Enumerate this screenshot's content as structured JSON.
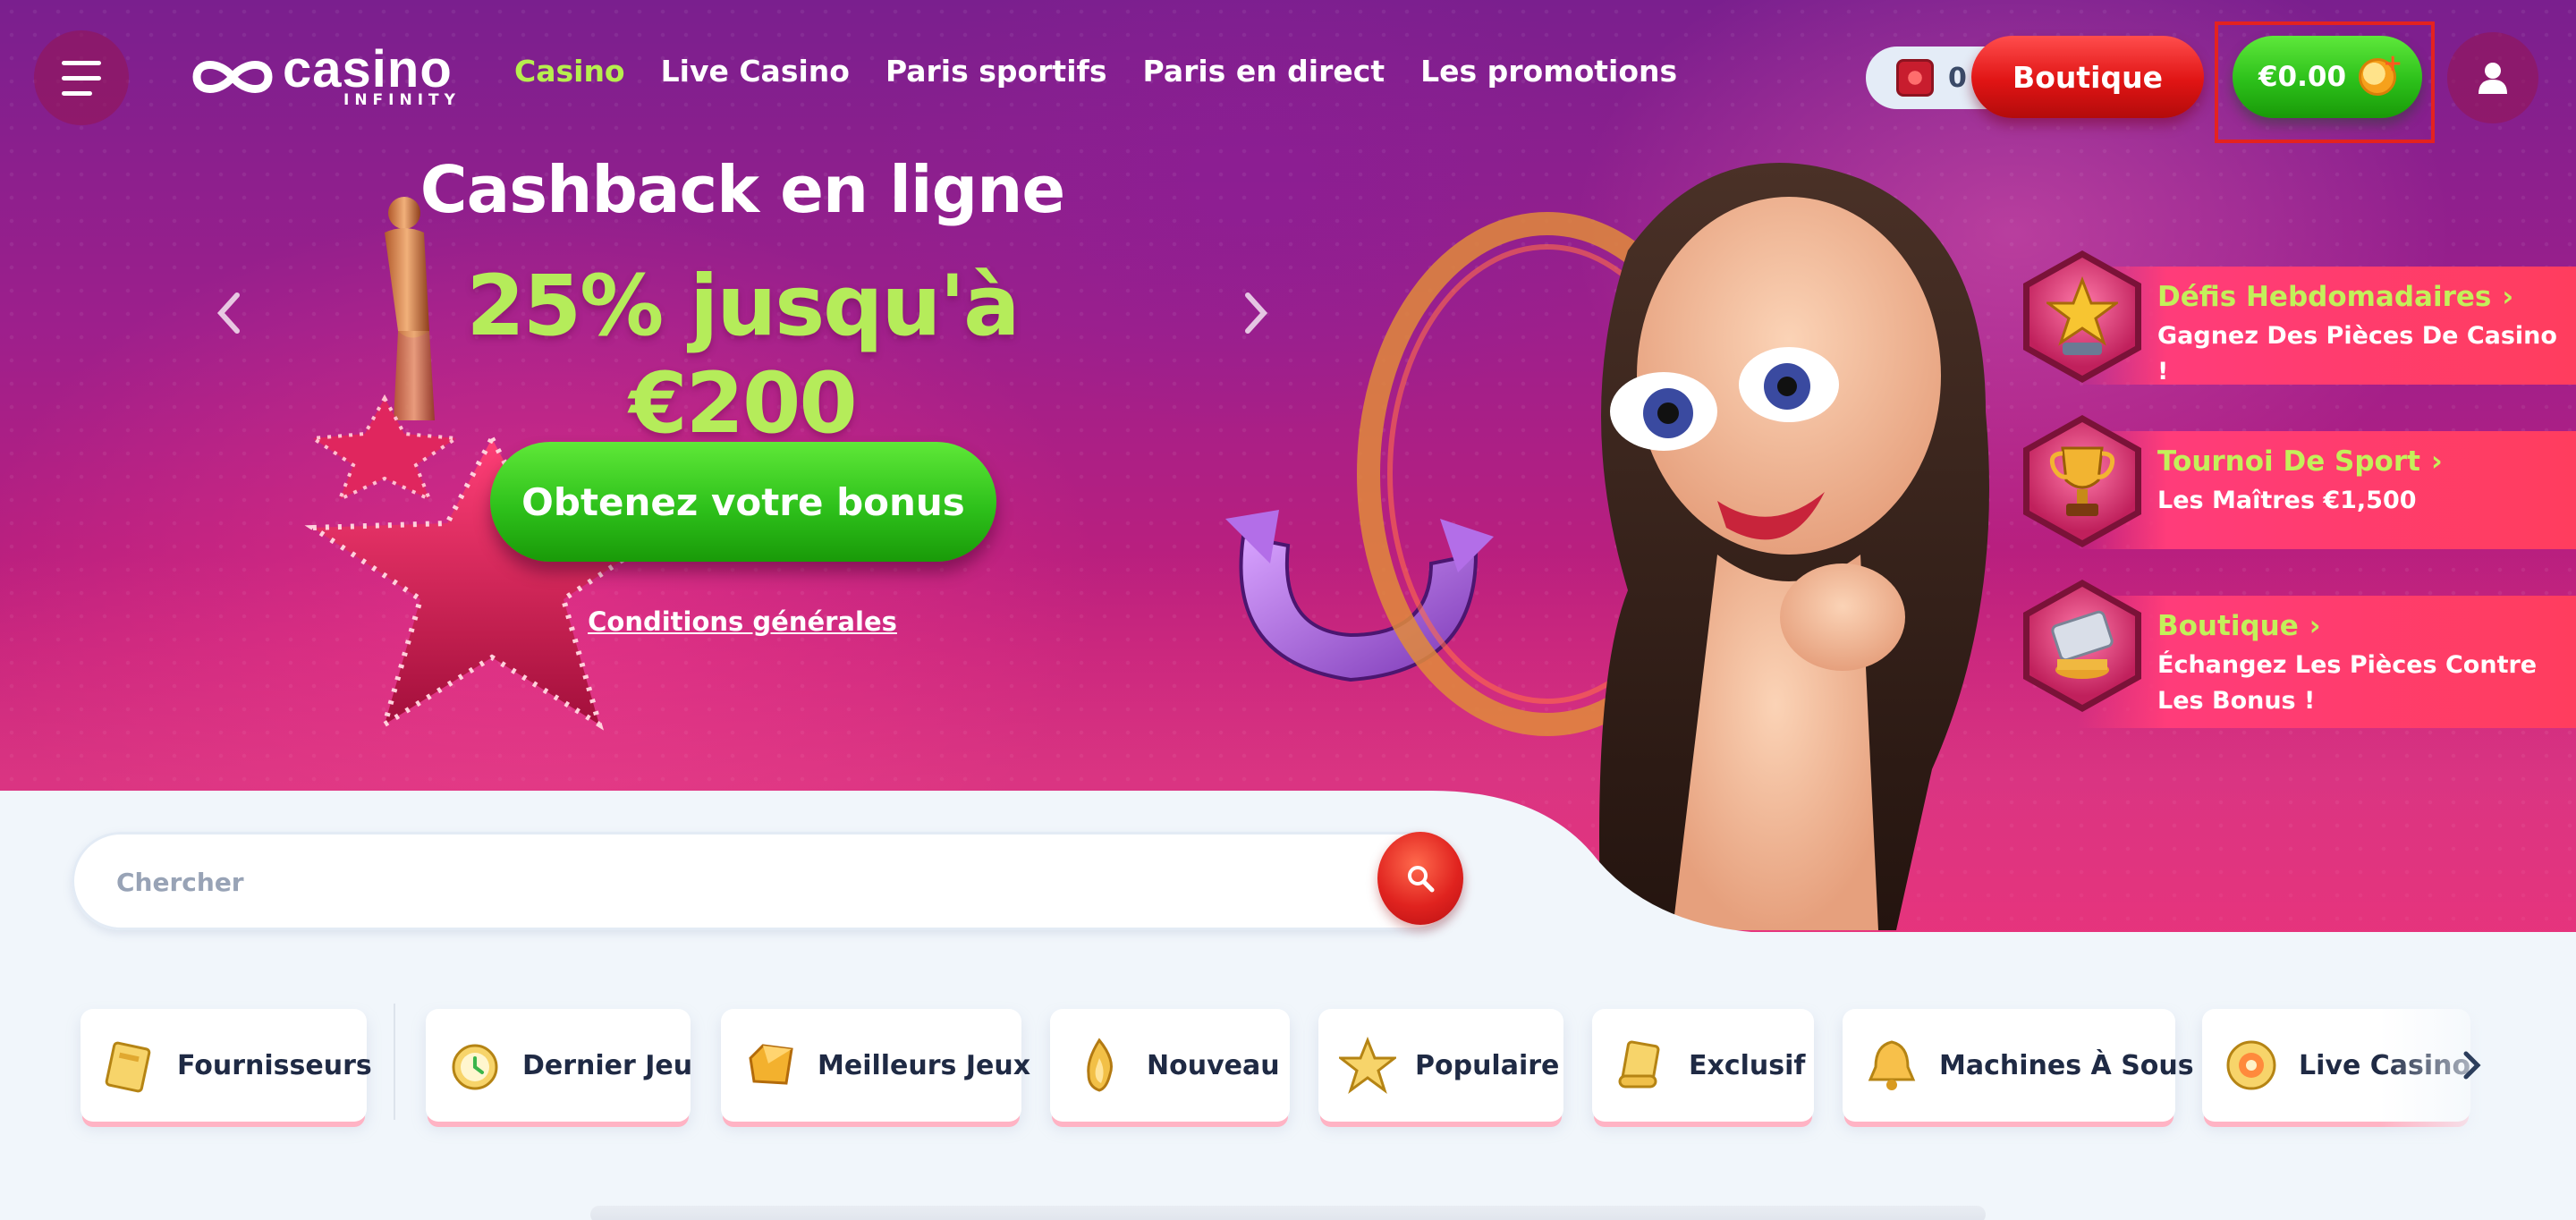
{
  "header": {
    "menu_icon": "hamburger-icon",
    "logo": {
      "main": "casino",
      "sub": "INFINITY"
    },
    "nav": [
      {
        "label": "Casino",
        "active": true
      },
      {
        "label": "Live Casino",
        "active": false
      },
      {
        "label": "Paris sportifs",
        "active": false
      },
      {
        "label": "Paris en direct",
        "active": false
      },
      {
        "label": "Les promotions",
        "active": false
      }
    ],
    "coins_count": "0",
    "boutique_label": "Boutique",
    "wallet_balance": "€0.00",
    "user_icon": "user-icon"
  },
  "hero": {
    "title": "Cashback en ligne",
    "subtitle": "25% jusqu'à €200",
    "cta_label": "Obtenez votre bonus",
    "terms_label": "Conditions générales"
  },
  "side_promos": [
    {
      "title": "Défis Hebdomadaires",
      "desc": "Gagnez Des Pièces De Casino !",
      "icon": "star-trophy-icon"
    },
    {
      "title": "Tournoi De Sport",
      "desc": "Les Maîtres €1,500",
      "icon": "trophy-icon"
    },
    {
      "title": "Boutique",
      "desc": "Échangez Les Pièces Contre Les Bonus !",
      "icon": "card-icon"
    }
  ],
  "search": {
    "placeholder": "Chercher"
  },
  "categories": [
    {
      "label": "Fournisseurs",
      "icon": "book-icon"
    },
    {
      "label": "Dernier Jeu",
      "icon": "clock-icon"
    },
    {
      "label": "Meilleurs Jeux",
      "icon": "gem-icon"
    },
    {
      "label": "Nouveau",
      "icon": "flame-icon"
    },
    {
      "label": "Populaire",
      "icon": "star-icon"
    },
    {
      "label": "Exclusif",
      "icon": "scroll-icon"
    },
    {
      "label": "Machines À Sous",
      "icon": "bell-icon"
    },
    {
      "label": "Live Casino",
      "icon": "chip-icon"
    }
  ],
  "colors": {
    "accent_green": "#2ec11b",
    "accent_red": "#e01414",
    "nav_active": "#b7ee4e"
  }
}
